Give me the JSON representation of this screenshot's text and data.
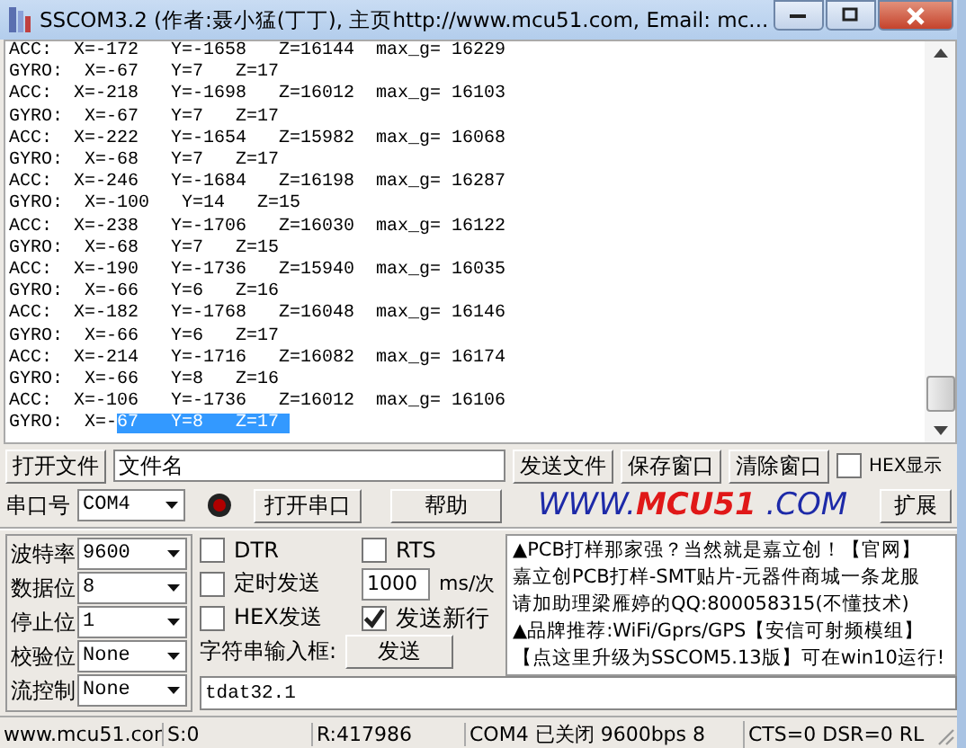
{
  "window": {
    "title": "SSCOM3.2 (作者:聂小猛(丁丁), 主页http://www.mcu51.com,  Email: mc..."
  },
  "log": {
    "lines": [
      {
        "text": "ACC:  X=-172   Y=-1658   Z=16144  max_g= 16229"
      },
      {
        "text": "GYRO:  X=-67   Y=7   Z=17"
      },
      {
        "text": "ACC:  X=-218   Y=-1698   Z=16012  max_g= 16103"
      },
      {
        "text": "GYRO:  X=-67   Y=7   Z=17"
      },
      {
        "text": "ACC:  X=-222   Y=-1654   Z=15982  max_g= 16068"
      },
      {
        "text": "GYRO:  X=-68   Y=7   Z=17"
      },
      {
        "text": "ACC:  X=-246   Y=-1684   Z=16198  max_g= 16287"
      },
      {
        "text": "GYRO:  X=-100   Y=14   Z=15"
      },
      {
        "text": "ACC:  X=-238   Y=-1706   Z=16030  max_g= 16122"
      },
      {
        "text": "GYRO:  X=-68   Y=7   Z=15"
      },
      {
        "text": "ACC:  X=-190   Y=-1736   Z=15940  max_g= 16035"
      },
      {
        "text": "GYRO:  X=-66   Y=6   Z=16"
      },
      {
        "text": "ACC:  X=-182   Y=-1768   Z=16048  max_g= 16146"
      },
      {
        "text": "GYRO:  X=-66   Y=6   Z=17"
      },
      {
        "text": "ACC:  X=-214   Y=-1716   Z=16082  max_g= 16174"
      },
      {
        "text": "GYRO:  X=-66   Y=8   Z=16"
      },
      {
        "text": "ACC:  X=-106   Y=-1736   Z=16012  max_g= 16106"
      },
      {
        "text": "GYRO:  X=-",
        "selected_text": "67   Y=8   Z=17 "
      }
    ]
  },
  "file_row": {
    "open_file_button": "打开文件",
    "file_name": "文件名",
    "send_file_button": "发送文件",
    "save_window_button": "保存窗口",
    "clear_window_button": "清除窗口",
    "hex_display": {
      "label": "HEX显示",
      "checked": false
    }
  },
  "port_row": {
    "label": "串口号",
    "port": "COM4",
    "open_port_button": "打开串口",
    "help_button": "帮助",
    "logo": {
      "left": "WWW.",
      "middle": "MCU51",
      "right": " .COM"
    },
    "expand_button": "扩展"
  },
  "settings": [
    {
      "label": "波特率",
      "value": "9600"
    },
    {
      "label": "数据位",
      "value": "8"
    },
    {
      "label": "停止位",
      "value": "1"
    },
    {
      "label": "校验位",
      "value": "None"
    },
    {
      "label": "流控制",
      "value": "None"
    }
  ],
  "options": {
    "dtr": {
      "label": "DTR",
      "checked": false
    },
    "rts": {
      "label": "RTS",
      "checked": false
    },
    "timed_send": {
      "label": "定时发送",
      "checked": false
    },
    "interval": "1000",
    "interval_unit": "ms/次",
    "hex_send": {
      "label": "HEX发送",
      "checked": false
    },
    "send_newline": {
      "label": "发送新行",
      "checked": true
    },
    "input_label": "字符串输入框:",
    "send_button": "发送",
    "input_value": "tdat32.1"
  },
  "ad": [
    "▲PCB打样那家强？当然就是嘉立创！【官网】",
    "嘉立创PCB打样-SMT贴片-元器件商城一条龙服",
    "请加助理梁雁婷的QQ:800058315(不懂技术)",
    "▲品牌推荐:WiFi/Gprs/GPS【安信可射频模组】",
    "【点这里升级为SSCOM5.13版】可在win10运行!"
  ],
  "status_bar": [
    "www.mcu51.cor",
    "S:0",
    "R:417986",
    "COM4 已关闭  9600bps  8",
    "CTS=0 DSR=0 RL"
  ]
}
